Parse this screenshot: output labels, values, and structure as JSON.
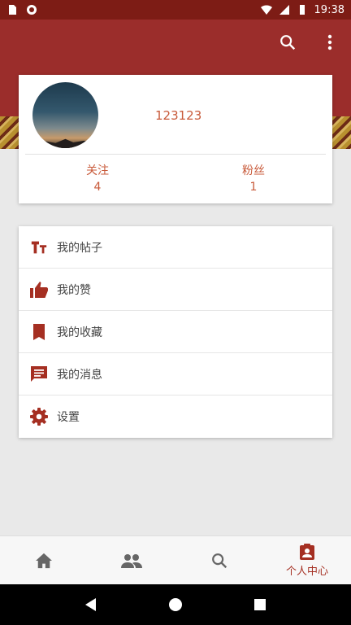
{
  "status_bar": {
    "time": "19:38"
  },
  "profile": {
    "username": "123123",
    "following_label": "关注",
    "following_count": "4",
    "fans_label": "粉丝",
    "fans_count": "1"
  },
  "menu": {
    "items": [
      {
        "label": "我的帖子",
        "icon": "text-format-icon"
      },
      {
        "label": "我的赞",
        "icon": "thumb-up-icon"
      },
      {
        "label": "我的收藏",
        "icon": "bookmark-icon"
      },
      {
        "label": "我的消息",
        "icon": "message-icon"
      },
      {
        "label": "设置",
        "icon": "settings-icon"
      }
    ]
  },
  "bottom_nav": {
    "items": [
      {
        "icon": "home-icon",
        "label": ""
      },
      {
        "icon": "people-icon",
        "label": ""
      },
      {
        "icon": "search-icon",
        "label": ""
      },
      {
        "icon": "profile-icon",
        "label": "个人中心",
        "active": true
      }
    ]
  },
  "colors": {
    "accent": "#a52f22",
    "header": "#9b2d2b",
    "status_bar": "#7d1c15",
    "text_accent": "#c85a3a"
  }
}
